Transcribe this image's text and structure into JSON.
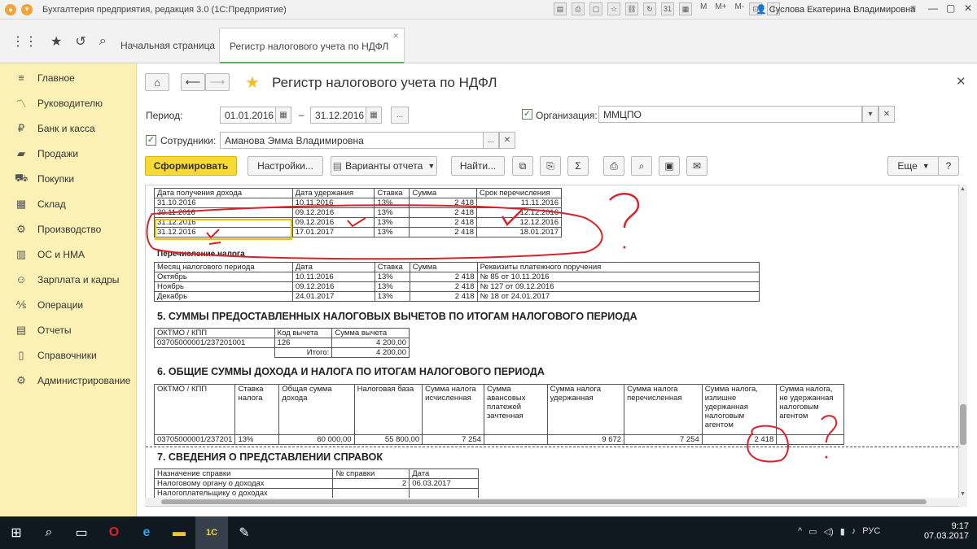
{
  "window": {
    "title": "Бухгалтерия предприятия, редакция 3.0 (1С:Предприятие)",
    "user": "Суслова Екатерина Владимировна",
    "mem_buttons": [
      "M",
      "M+",
      "M-"
    ]
  },
  "tabs": [
    {
      "label": "Начальная страница"
    },
    {
      "label": "Регистр налогового учета по НДФЛ"
    }
  ],
  "sidebar": {
    "items": [
      {
        "label": "Главное",
        "icon": "menu-lines-icon"
      },
      {
        "label": "Руководителю",
        "icon": "chart-line-icon"
      },
      {
        "label": "Банк и касса",
        "icon": "coin-icon"
      },
      {
        "label": "Продажи",
        "icon": "cart-icon"
      },
      {
        "label": "Покупки",
        "icon": "basket-icon"
      },
      {
        "label": "Склад",
        "icon": "warehouse-icon"
      },
      {
        "label": "Производство",
        "icon": "factory-icon"
      },
      {
        "label": "ОС и НМА",
        "icon": "building-icon"
      },
      {
        "label": "Зарплата и кадры",
        "icon": "people-icon"
      },
      {
        "label": "Операции",
        "icon": "operations-icon"
      },
      {
        "label": "Отчеты",
        "icon": "report-icon"
      },
      {
        "label": "Справочники",
        "icon": "book-icon"
      },
      {
        "label": "Администрирование",
        "icon": "gear-icon"
      }
    ]
  },
  "form": {
    "title": "Регистр налогового учета по НДФЛ",
    "period_label": "Период:",
    "date_from": "01.01.2016",
    "date_to": "31.12.2016",
    "dash": "–",
    "dots": "...",
    "org_label": "Организация:",
    "org_value": "ММЦПО",
    "emp_label": "Сотрудники:",
    "emp_value": "Аманова Эмма Владимировна",
    "generate": "Сформировать",
    "settings": "Настройки...",
    "variants": "Варианты отчета",
    "find": "Найти...",
    "sigma": "Σ",
    "more": "Еще",
    "help": "?"
  },
  "report": {
    "t1_header": [
      "Дата получения дохода",
      "Дата удержания",
      "Ставка",
      "Сумма",
      "Срок перечисления"
    ],
    "t1_rows": [
      [
        "31.10.2016",
        "10.11.2016",
        "13%",
        "2 418",
        "11.11.2016"
      ],
      [
        "30.11.2016",
        "09.12.2016",
        "13%",
        "2 418",
        "12.12.2016"
      ],
      [
        "31.12.2016",
        "09.12.2016",
        "13%",
        "2 418",
        "12.12.2016"
      ],
      [
        "31.12.2016",
        "17.01.2017",
        "13%",
        "2 418",
        "18.01.2017"
      ]
    ],
    "t2_title": "Перечисление налога",
    "t2_header": [
      "Месяц налогового периода",
      "Дата",
      "Ставка",
      "Сумма",
      "Реквизиты платежного поручения"
    ],
    "t2_rows": [
      [
        "Октябрь",
        "10.11.2016",
        "13%",
        "2 418",
        "№ 85 от 10.11.2016"
      ],
      [
        "Ноябрь",
        "09.12.2016",
        "13%",
        "2 418",
        "№ 127 от 09.12.2016"
      ],
      [
        "Декабрь",
        "24.01.2017",
        "13%",
        "2 418",
        "№ 18 от 24.01.2017"
      ]
    ],
    "sec5": "5. СУММЫ ПРЕДОСТАВЛЕННЫХ НАЛОГОВЫХ ВЫЧЕТОВ ПО ИТОГАМ НАЛОГОВОГО ПЕРИОДА",
    "t5_header": [
      "ОКТМО / КПП",
      "Код вычета",
      "Сумма вычета"
    ],
    "t5_row": [
      "03705000001/237201001",
      "126",
      "4 200,00"
    ],
    "t5_total_label": "Итого:",
    "t5_total": "4 200,00",
    "sec6": "6. ОБЩИЕ СУММЫ ДОХОДА И НАЛОГА ПО ИТОГАМ НАЛОГОВОГО ПЕРИОДА",
    "t6_header": [
      "ОКТМО / КПП",
      "Ставка налога",
      "Общая сумма дохода",
      "Налоговая база",
      "Сумма налога исчисленная",
      "Сумма авансовых платежей зачтенная",
      "Сумма налога удержанная",
      "Сумма налога перечисленная",
      "Сумма налога, излишне удержанная налоговым агентом",
      "Сумма налога, не удержанная налоговым агентом"
    ],
    "t6_row": [
      "03705000001/237201",
      "13%",
      "60 000,00",
      "55 800,00",
      "7 254",
      "",
      "9 672",
      "7 254",
      "2 418",
      ""
    ],
    "sec7": "7. СВЕДЕНИЯ О ПРЕДСТАВЛЕНИИ СПРАВОК",
    "t7_header": [
      "Назначение справки",
      "№ справки",
      "Дата"
    ],
    "t7_rows": [
      [
        "Налоговому органу о доходах",
        "2",
        "06.03.2017"
      ],
      [
        "Налогоплательщику о доходах",
        "",
        ""
      ]
    ]
  },
  "taskbar": {
    "lang": "РУС",
    "time": "9:17",
    "date": "07.03.2017"
  }
}
